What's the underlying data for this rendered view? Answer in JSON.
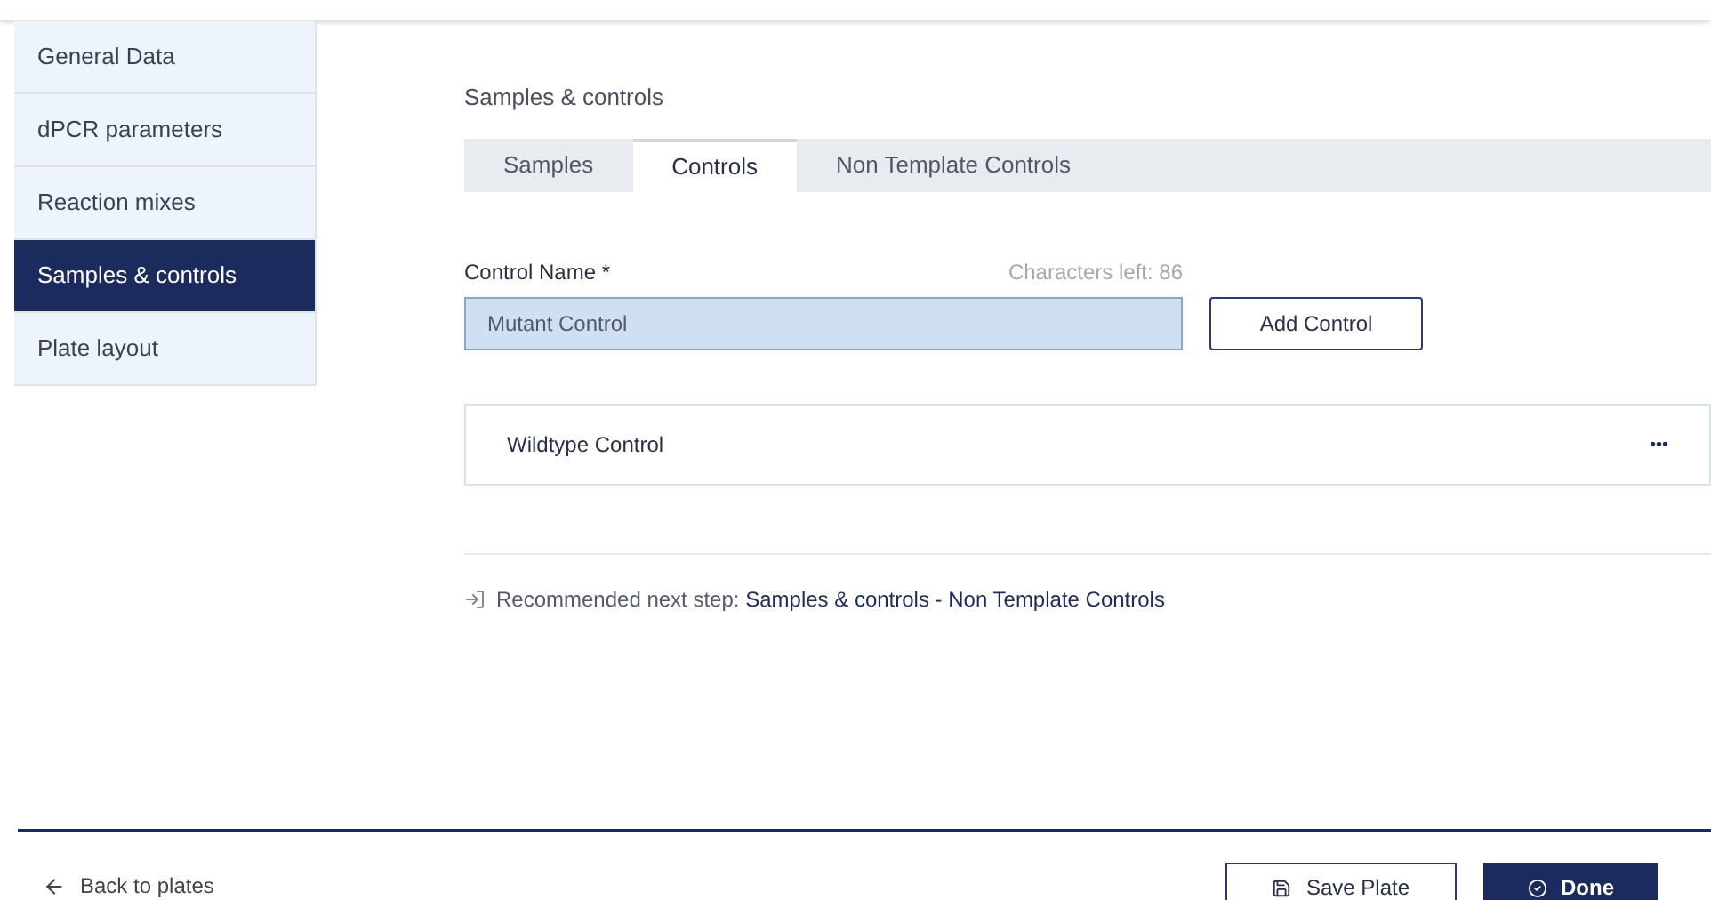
{
  "sidebar": {
    "items": [
      {
        "label": "General Data",
        "selected": false
      },
      {
        "label": "dPCR parameters",
        "selected": false
      },
      {
        "label": "Reaction mixes",
        "selected": false
      },
      {
        "label": "Samples & controls",
        "selected": true
      },
      {
        "label": "Plate layout",
        "selected": false
      }
    ]
  },
  "heading": "Samples & controls",
  "tabs": [
    {
      "label": "Samples",
      "selected": false
    },
    {
      "label": "Controls",
      "selected": true
    },
    {
      "label": "Non Template Controls",
      "selected": false
    }
  ],
  "form": {
    "label": "Control Name *",
    "counter": "Characters left: 86",
    "value": "Mutant Control",
    "button": "Add Control"
  },
  "controls": [
    {
      "name": "Wildtype Control",
      "menu": "•••"
    }
  ],
  "next_step": {
    "prefix": "Recommended next step:",
    "link": "Samples & controls - Non Template Controls"
  },
  "footer": {
    "back": "Back to plates",
    "save": "Save Plate",
    "done": "Done"
  }
}
